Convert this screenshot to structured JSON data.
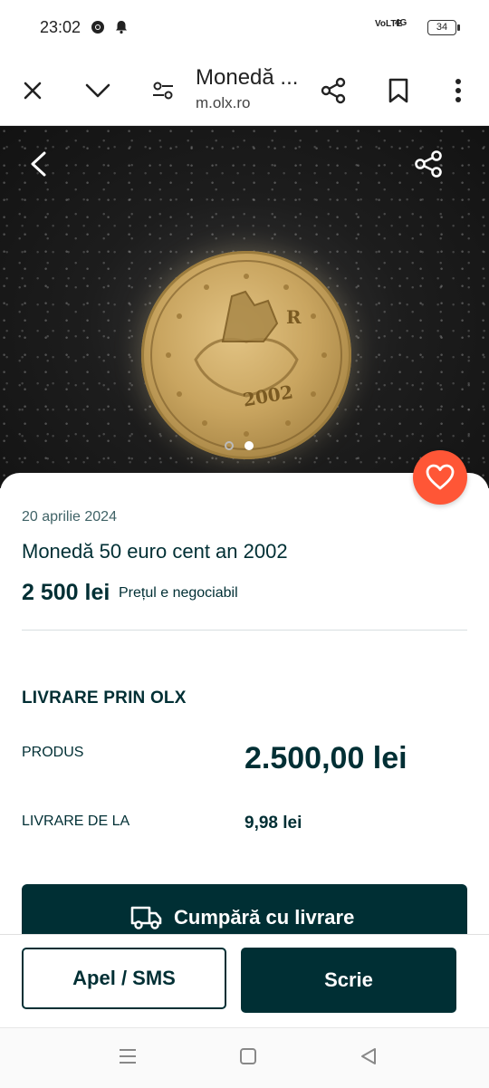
{
  "status_bar": {
    "time": "23:02",
    "network": "VoLTE",
    "signal": "4G",
    "battery": "34"
  },
  "browser": {
    "page_title": "Monedă ...",
    "url": "m.olx.ro",
    "icons": [
      "close-icon",
      "chevron-down-icon",
      "tune-icon",
      "share-icon",
      "bookmark-icon",
      "more-vert-icon"
    ]
  },
  "gallery": {
    "coin_year": "2002",
    "image_count": 2,
    "active_index": 1
  },
  "listing": {
    "date": "20 aprilie 2024",
    "title": "Monedă 50 euro cent an 2002",
    "price": "2 500 lei",
    "negotiable": "Prețul e negociabil"
  },
  "delivery": {
    "heading": "LIVRARE PRIN OLX",
    "product_label": "PRODUS",
    "product_value": "2.500,00 lei",
    "shipping_label": "LIVRARE DE LA",
    "shipping_value": "9,98 lei",
    "buy_label": "Cumpără cu livrare"
  },
  "actions": {
    "call": "Apel / SMS",
    "write": "Scrie"
  },
  "colors": {
    "primary": "#002f34",
    "favorite": "#ff5636"
  }
}
